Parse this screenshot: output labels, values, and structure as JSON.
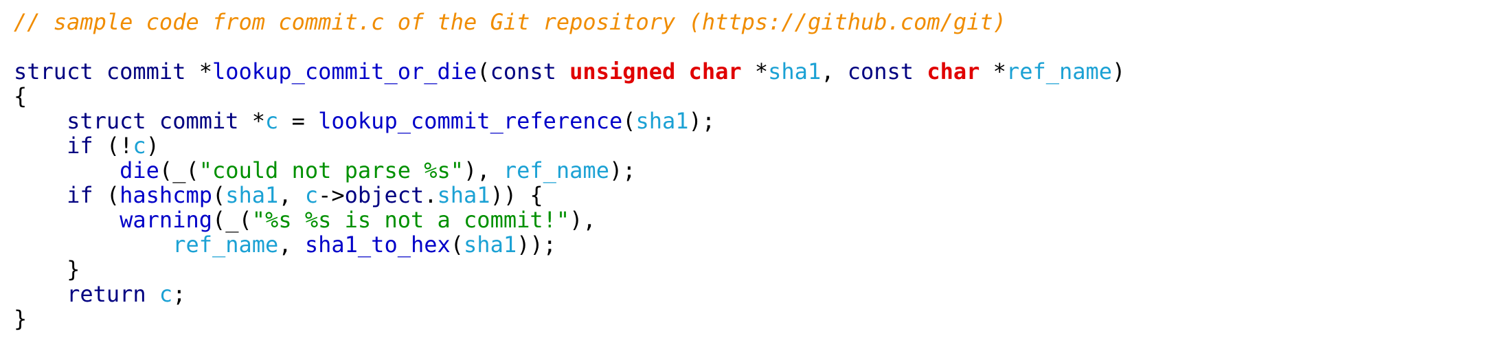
{
  "code": {
    "language": "c",
    "lines": [
      [
        {
          "text": "// sample code from commit.c of the Git repository (https://github.com/git)",
          "kind": "comment"
        }
      ],
      [],
      [
        {
          "text": "struct",
          "kind": "type"
        },
        {
          "text": " ",
          "kind": "plain"
        },
        {
          "text": "commit",
          "kind": "type"
        },
        {
          "text": " *",
          "kind": "plain"
        },
        {
          "text": "lookup_commit_or_die",
          "kind": "func"
        },
        {
          "text": "(",
          "kind": "plain"
        },
        {
          "text": "const",
          "kind": "type"
        },
        {
          "text": " ",
          "kind": "plain"
        },
        {
          "text": "unsigned char",
          "kind": "red"
        },
        {
          "text": " *",
          "kind": "plain"
        },
        {
          "text": "sha1",
          "kind": "ident"
        },
        {
          "text": ", ",
          "kind": "plain"
        },
        {
          "text": "const",
          "kind": "type"
        },
        {
          "text": " ",
          "kind": "plain"
        },
        {
          "text": "char",
          "kind": "red"
        },
        {
          "text": " *",
          "kind": "plain"
        },
        {
          "text": "ref_name",
          "kind": "ident"
        },
        {
          "text": ")",
          "kind": "plain"
        }
      ],
      [
        {
          "text": "{",
          "kind": "plain"
        }
      ],
      [
        {
          "text": "    ",
          "kind": "plain"
        },
        {
          "text": "struct",
          "kind": "type"
        },
        {
          "text": " ",
          "kind": "plain"
        },
        {
          "text": "commit",
          "kind": "type"
        },
        {
          "text": " *",
          "kind": "plain"
        },
        {
          "text": "c",
          "kind": "ident"
        },
        {
          "text": " = ",
          "kind": "plain"
        },
        {
          "text": "lookup_commit_reference",
          "kind": "func"
        },
        {
          "text": "(",
          "kind": "plain"
        },
        {
          "text": "sha1",
          "kind": "ident"
        },
        {
          "text": ");",
          "kind": "plain"
        }
      ],
      [
        {
          "text": "    ",
          "kind": "plain"
        },
        {
          "text": "if",
          "kind": "type"
        },
        {
          "text": " (!",
          "kind": "plain"
        },
        {
          "text": "c",
          "kind": "ident"
        },
        {
          "text": ")",
          "kind": "plain"
        }
      ],
      [
        {
          "text": "        ",
          "kind": "plain"
        },
        {
          "text": "die",
          "kind": "func"
        },
        {
          "text": "(_(",
          "kind": "plain"
        },
        {
          "text": "\"could not parse %s\"",
          "kind": "string"
        },
        {
          "text": "), ",
          "kind": "plain"
        },
        {
          "text": "ref_name",
          "kind": "ident"
        },
        {
          "text": ");",
          "kind": "plain"
        }
      ],
      [
        {
          "text": "    ",
          "kind": "plain"
        },
        {
          "text": "if",
          "kind": "type"
        },
        {
          "text": " (",
          "kind": "plain"
        },
        {
          "text": "hashcmp",
          "kind": "func"
        },
        {
          "text": "(",
          "kind": "plain"
        },
        {
          "text": "sha1",
          "kind": "ident"
        },
        {
          "text": ", ",
          "kind": "plain"
        },
        {
          "text": "c",
          "kind": "ident"
        },
        {
          "text": "->",
          "kind": "plain"
        },
        {
          "text": "object",
          "kind": "type"
        },
        {
          "text": ".",
          "kind": "plain"
        },
        {
          "text": "sha1",
          "kind": "ident"
        },
        {
          "text": ")) {",
          "kind": "plain"
        }
      ],
      [
        {
          "text": "        ",
          "kind": "plain"
        },
        {
          "text": "warning",
          "kind": "func"
        },
        {
          "text": "(_(",
          "kind": "plain"
        },
        {
          "text": "\"%s %s is not a commit!\"",
          "kind": "string"
        },
        {
          "text": "),",
          "kind": "plain"
        }
      ],
      [
        {
          "text": "            ",
          "kind": "plain"
        },
        {
          "text": "ref_name",
          "kind": "ident"
        },
        {
          "text": ", ",
          "kind": "plain"
        },
        {
          "text": "sha1_to_hex",
          "kind": "func"
        },
        {
          "text": "(",
          "kind": "plain"
        },
        {
          "text": "sha1",
          "kind": "ident"
        },
        {
          "text": "));",
          "kind": "plain"
        }
      ],
      [
        {
          "text": "    }",
          "kind": "plain"
        }
      ],
      [
        {
          "text": "    ",
          "kind": "plain"
        },
        {
          "text": "return",
          "kind": "type"
        },
        {
          "text": " ",
          "kind": "plain"
        },
        {
          "text": "c",
          "kind": "ident"
        },
        {
          "text": ";",
          "kind": "plain"
        }
      ],
      [
        {
          "text": "}",
          "kind": "plain"
        }
      ]
    ]
  },
  "colors": {
    "comment": "#f08c00",
    "type": "#000080",
    "func": "#0000c8",
    "ident": "#1ba1d4",
    "red": "#e00000",
    "string": "#009000",
    "plain": "#000000",
    "background": "#ffffff"
  }
}
